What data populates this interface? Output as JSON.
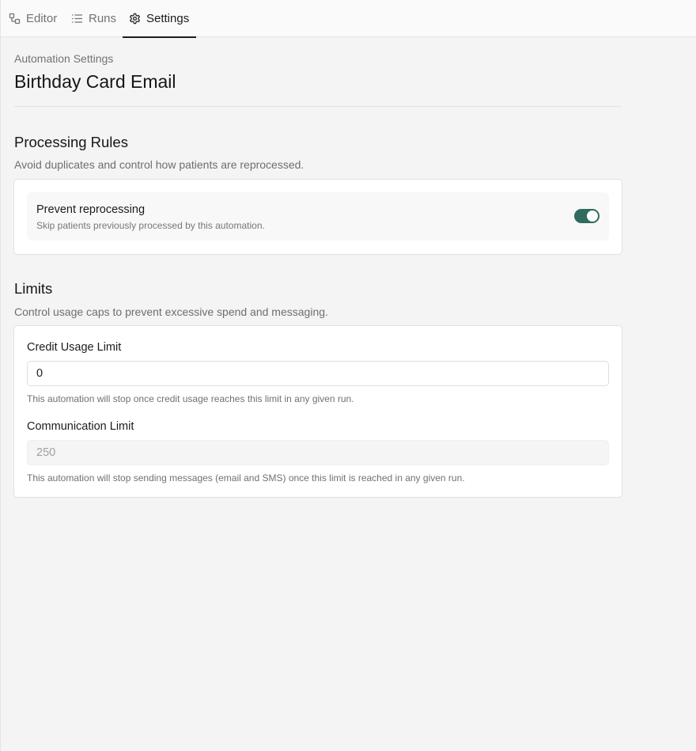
{
  "tabs": {
    "editor": "Editor",
    "runs": "Runs",
    "settings": "Settings",
    "active": "settings"
  },
  "header": {
    "eyebrow": "Automation Settings",
    "title": "Birthday Card Email"
  },
  "processing_rules": {
    "title": "Processing Rules",
    "description": "Avoid duplicates and control how patients are reprocessed.",
    "prevent_reprocessing": {
      "label": "Prevent reprocessing",
      "description": "Skip patients previously processed by this automation.",
      "enabled": true
    }
  },
  "limits": {
    "title": "Limits",
    "description": "Control usage caps to prevent excessive spend and messaging.",
    "credit_usage": {
      "label": "Credit Usage Limit",
      "value": "0",
      "help": "This automation will stop once credit usage reaches this limit in any given run."
    },
    "communication": {
      "label": "Communication Limit",
      "placeholder": "250",
      "help": "This automation will stop sending messages (email and SMS) once this limit is reached in any given run."
    }
  },
  "colors": {
    "accent": "#2f6b5e",
    "background": "#f3f4f3",
    "card": "#ffffff"
  }
}
